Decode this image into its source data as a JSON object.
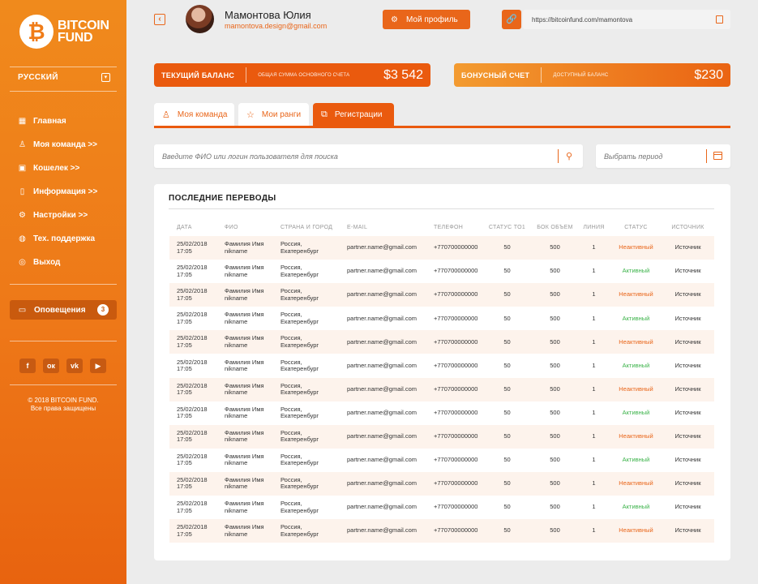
{
  "sidebar": {
    "logo": {
      "line1": "BITCOIN",
      "line2": "FUND"
    },
    "language": "РУССКИЙ",
    "nav": [
      {
        "label": "Главная",
        "icon": "grid-icon"
      },
      {
        "label": "Моя команда >>",
        "icon": "user-icon"
      },
      {
        "label": "Кошелек >>",
        "icon": "wallet-icon"
      },
      {
        "label": "Информация >>",
        "icon": "bookmark-icon"
      },
      {
        "label": "Настройки >>",
        "icon": "gear-icon"
      },
      {
        "label": "Тех. поддержка",
        "icon": "globe-icon"
      },
      {
        "label": "Выход",
        "icon": "power-icon"
      }
    ],
    "notifications": {
      "label": "Оповещения",
      "count": "3"
    },
    "socials": [
      "facebook-icon",
      "odnoklassniki-icon",
      "vk-icon",
      "youtube-icon"
    ],
    "copyright": {
      "line1": "© 2018 BITCOIN FUND.",
      "line2": "Все права защищены"
    }
  },
  "header": {
    "user_name": "Мамонтова Юлия",
    "user_email": "mamontova.design@gmail.com",
    "profile_button": "Мой профиль",
    "referral_link": "https://bitcoinfund.com/mamontova"
  },
  "balance": {
    "current": {
      "label": "ТЕКУЩИЙ БАЛАНС",
      "sub": "ОБЩАЯ СУММА ОСНОВНОГО СЧЁТА",
      "value": "$3 542"
    },
    "bonus": {
      "label": "БОНУСНЫЙ СЧЕТ",
      "sub": "ДОСТУПНЫЙ БАЛАНС",
      "value": "$230"
    }
  },
  "tabs": [
    {
      "label": "Моя команда",
      "icon": "user-icon"
    },
    {
      "label": "Мои ранги",
      "icon": "star-icon"
    },
    {
      "label": "Регистрации",
      "icon": "network-icon",
      "active": true
    }
  ],
  "search": {
    "placeholder": "Введите ФИО или логин пользователя для поиска"
  },
  "period": {
    "placeholder": "Выбрать период"
  },
  "transfers": {
    "title": "ПОСЛЕДНИЕ ПЕРЕВОДЫ",
    "columns": [
      "ДАТА",
      "ФИО",
      "СТРАНА И ГОРОД",
      "E-MAIL",
      "ТЕЛЕФОН",
      "СТАТУС TO1",
      "БОК ОБЪЕМ",
      "ЛИНИЯ",
      "СТАТУС",
      "ИСТОЧНИК"
    ],
    "rows": [
      {
        "date": "25/02/2018",
        "time": "17:05",
        "name1": "Фамилия Имя",
        "name2": "nikname",
        "country": "Россия,",
        "city": "Екатеренбург",
        "email": "partner.name@gmail.com",
        "phone": "+770700000000",
        "status_to1": "50",
        "volume": "500",
        "line": "1",
        "status": "Неактивный",
        "active": false,
        "source": "Источник"
      },
      {
        "date": "25/02/2018",
        "time": "17:05",
        "name1": "Фамилия Имя",
        "name2": "nikname",
        "country": "Россия,",
        "city": "Екатеренбург",
        "email": "partner.name@gmail.com",
        "phone": "+770700000000",
        "status_to1": "50",
        "volume": "500",
        "line": "1",
        "status": "Активный",
        "active": true,
        "source": "Источник"
      },
      {
        "date": "25/02/2018",
        "time": "17:05",
        "name1": "Фамилия Имя",
        "name2": "nikname",
        "country": "Россия,",
        "city": "Екатеренбург",
        "email": "partner.name@gmail.com",
        "phone": "+770700000000",
        "status_to1": "50",
        "volume": "500",
        "line": "1",
        "status": "Неактивный",
        "active": false,
        "source": "Источник"
      },
      {
        "date": "25/02/2018",
        "time": "17:05",
        "name1": "Фамилия Имя",
        "name2": "nikname",
        "country": "Россия,",
        "city": "Екатеренбург",
        "email": "partner.name@gmail.com",
        "phone": "+770700000000",
        "status_to1": "50",
        "volume": "500",
        "line": "1",
        "status": "Активный",
        "active": true,
        "source": "Источник"
      },
      {
        "date": "25/02/2018",
        "time": "17:05",
        "name1": "Фамилия Имя",
        "name2": "nikname",
        "country": "Россия,",
        "city": "Екатеренбург",
        "email": "partner.name@gmail.com",
        "phone": "+770700000000",
        "status_to1": "50",
        "volume": "500",
        "line": "1",
        "status": "Неактивный",
        "active": false,
        "source": "Источник"
      },
      {
        "date": "25/02/2018",
        "time": "17:05",
        "name1": "Фамилия Имя",
        "name2": "nikname",
        "country": "Россия,",
        "city": "Екатеренбург",
        "email": "partner.name@gmail.com",
        "phone": "+770700000000",
        "status_to1": "50",
        "volume": "500",
        "line": "1",
        "status": "Активный",
        "active": true,
        "source": "Источник"
      },
      {
        "date": "25/02/2018",
        "time": "17:05",
        "name1": "Фамилия Имя",
        "name2": "nikname",
        "country": "Россия,",
        "city": "Екатеренбург",
        "email": "partner.name@gmail.com",
        "phone": "+770700000000",
        "status_to1": "50",
        "volume": "500",
        "line": "1",
        "status": "Неактивный",
        "active": false,
        "source": "Источник"
      },
      {
        "date": "25/02/2018",
        "time": "17:05",
        "name1": "Фамилия Имя",
        "name2": "nikname",
        "country": "Россия,",
        "city": "Екатеренбург",
        "email": "partner.name@gmail.com",
        "phone": "+770700000000",
        "status_to1": "50",
        "volume": "500",
        "line": "1",
        "status": "Активный",
        "active": true,
        "source": "Источник"
      },
      {
        "date": "25/02/2018",
        "time": "17:05",
        "name1": "Фамилия Имя",
        "name2": "nikname",
        "country": "Россия,",
        "city": "Екатеренбург",
        "email": "partner.name@gmail.com",
        "phone": "+770700000000",
        "status_to1": "50",
        "volume": "500",
        "line": "1",
        "status": "Неактивный",
        "active": false,
        "source": "Источник"
      },
      {
        "date": "25/02/2018",
        "time": "17:05",
        "name1": "Фамилия Имя",
        "name2": "nikname",
        "country": "Россия,",
        "city": "Екатеренбург",
        "email": "partner.name@gmail.com",
        "phone": "+770700000000",
        "status_to1": "50",
        "volume": "500",
        "line": "1",
        "status": "Активный",
        "active": true,
        "source": "Источник"
      },
      {
        "date": "25/02/2018",
        "time": "17:05",
        "name1": "Фамилия Имя",
        "name2": "nikname",
        "country": "Россия,",
        "city": "Екатеренбург",
        "email": "partner.name@gmail.com",
        "phone": "+770700000000",
        "status_to1": "50",
        "volume": "500",
        "line": "1",
        "status": "Неактивный",
        "active": false,
        "source": "Источник"
      },
      {
        "date": "25/02/2018",
        "time": "17:05",
        "name1": "Фамилия Имя",
        "name2": "nikname",
        "country": "Россия,",
        "city": "Екатеренбург",
        "email": "partner.name@gmail.com",
        "phone": "+770700000000",
        "status_to1": "50",
        "volume": "500",
        "line": "1",
        "status": "Активный",
        "active": true,
        "source": "Источник"
      },
      {
        "date": "25/02/2018",
        "time": "17:05",
        "name1": "Фамилия Имя",
        "name2": "nikname",
        "country": "Россия,",
        "city": "Екатеренбург",
        "email": "partner.name@gmail.com",
        "phone": "+770700000000",
        "status_to1": "50",
        "volume": "500",
        "line": "1",
        "status": "Неактивный",
        "active": false,
        "source": "Источник"
      }
    ]
  },
  "colors": {
    "accent": "#e9661a",
    "active": "#3cb34a",
    "sidebar": "#ee7818"
  }
}
